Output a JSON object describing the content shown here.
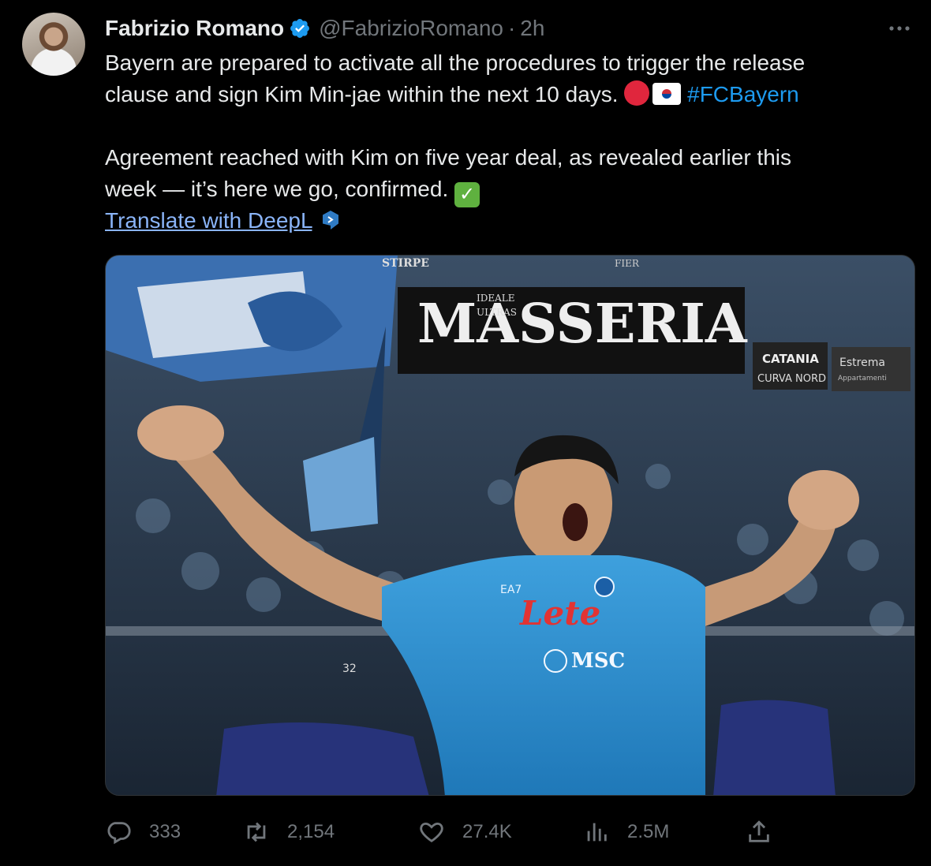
{
  "tweet": {
    "author_name": "Fabrizio Romano",
    "handle": "@FabrizioRomano",
    "separator": "·",
    "time": "2h",
    "text": {
      "line1": "Bayern are prepared to activate all the procedures to trigger the release",
      "line2": "clause and sign Kim Min-jae within the next 10 days.",
      "hashtag": "#FCBayern",
      "line3": "Agreement reached with Kim on five year deal, as revealed earlier this",
      "line4": "week — it’s here we go, confirmed.",
      "translate": "Translate with DeepL"
    }
  },
  "media": {
    "banner_main": "MASSERIA",
    "banner_small_1": "IDEALE",
    "banner_small_2": "ULTRAS",
    "banner_top": "STIRPE",
    "banner_fiera": "FIER",
    "sign_catania_1": "CATANIA",
    "sign_catania_2": "CURVA NORD",
    "sign_estrema_1": "Estrema",
    "sign_estrema_2": "Appartamenti",
    "shirt_sponsor": "Lete",
    "shirt_brand": "EA7",
    "shirt_msc": "MSC",
    "fan_number": "32"
  },
  "actions": {
    "replies": "333",
    "retweets": "2,154",
    "likes": "27.4K",
    "views": "2.5M"
  },
  "colors": {
    "background": "#000000",
    "text": "#e7e9ea",
    "muted": "#71767b",
    "link": "#1d9bf0",
    "verified": "#1d9bf0"
  },
  "icons": [
    "verified-badge-icon",
    "more-icon",
    "deepl-icon",
    "reply-icon",
    "retweet-icon",
    "like-icon",
    "views-icon",
    "share-icon"
  ]
}
